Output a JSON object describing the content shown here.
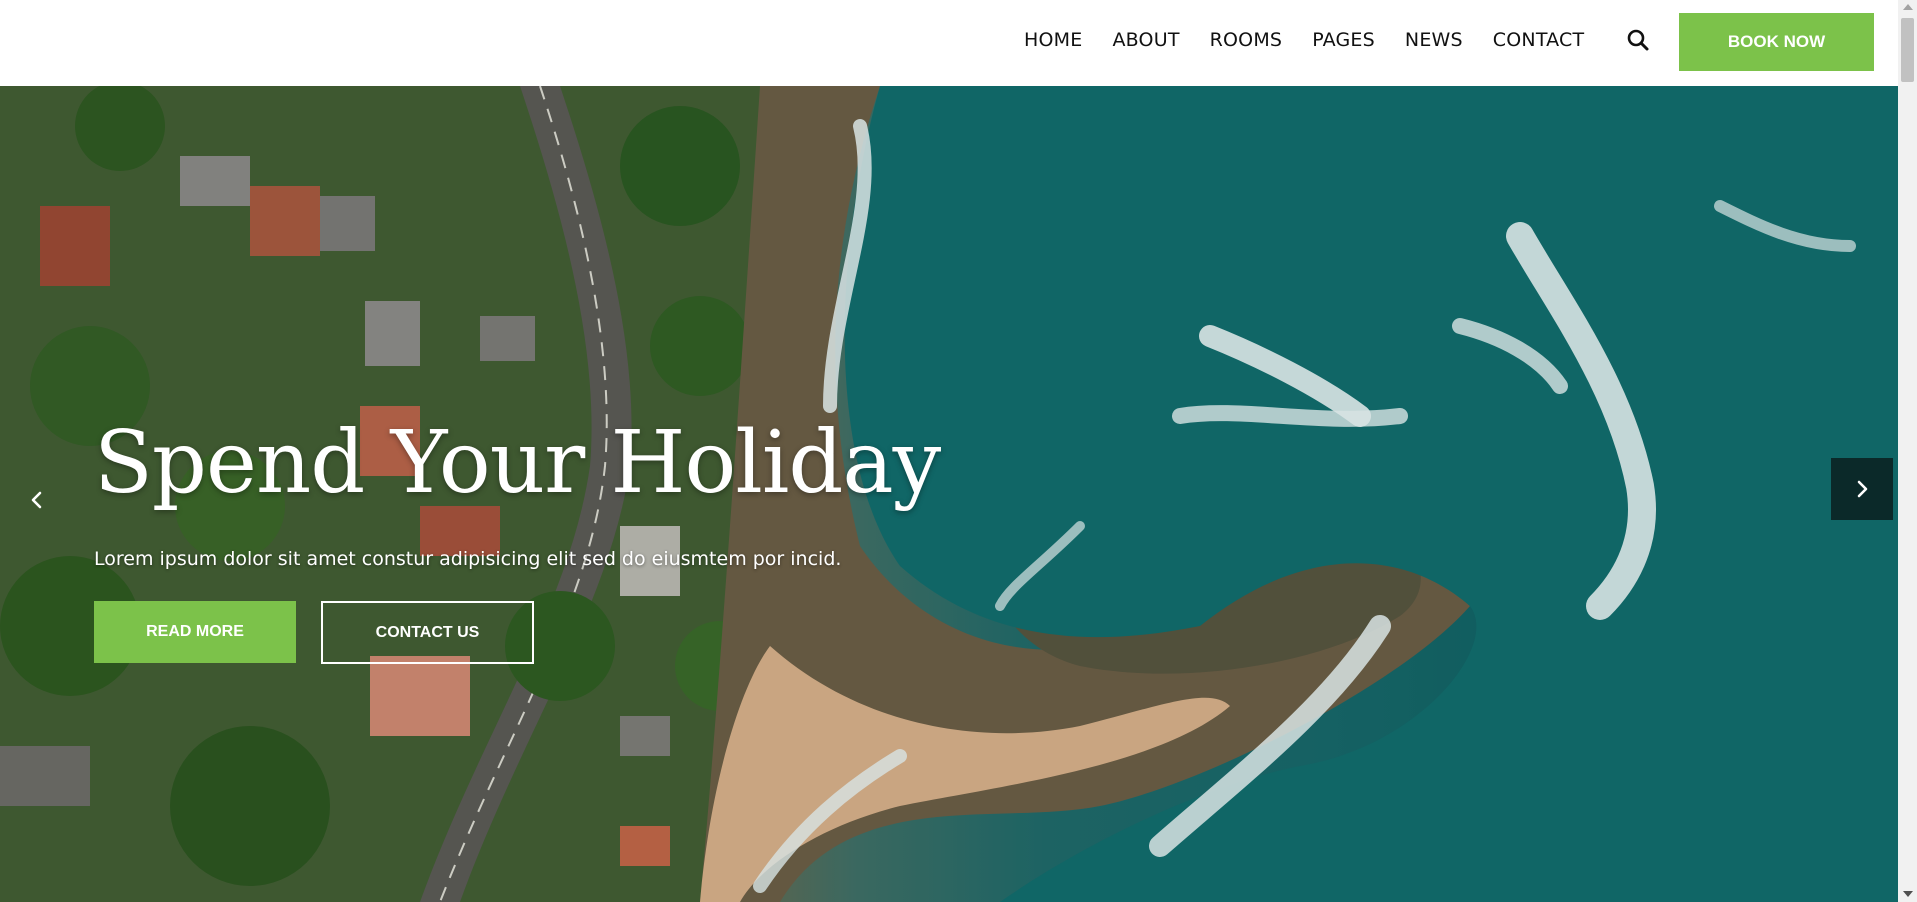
{
  "nav": {
    "items": [
      "HOME",
      "ABOUT",
      "ROOMS",
      "PAGES",
      "NEWS",
      "CONTACT"
    ],
    "search_icon": "search-icon",
    "book_now": "BOOK NOW"
  },
  "hero": {
    "title": "Spend Your Holiday",
    "subtitle": "Lorem ipsum dolor sit amet constur adipisicing elit sed do eiusmtem por incid.",
    "read_more": "READ MORE",
    "contact_us": "CONTACT US",
    "prev_icon": "chevron-left-icon",
    "next_icon": "chevron-right-icon"
  },
  "colors": {
    "accent": "#7cc24a",
    "text_dark": "#111111",
    "white": "#ffffff"
  }
}
